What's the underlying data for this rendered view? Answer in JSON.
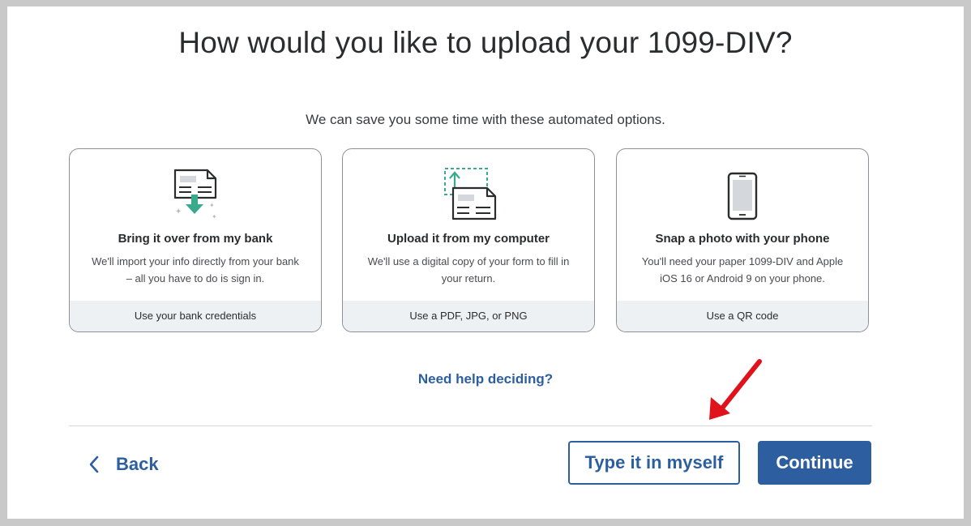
{
  "page": {
    "title": "How would you like to upload your 1099-DIV?",
    "subtitle": "We can save you some time with these automated options."
  },
  "options": [
    {
      "icon": "bank-import-icon",
      "heading": "Bring it over from my bank",
      "description": "We'll import your info directly from your bank – all you have to do is sign in.",
      "footer": "Use your bank credentials"
    },
    {
      "icon": "computer-upload-icon",
      "heading": "Upload it from my computer",
      "description": "We'll use a digital copy of your form to fill in your return.",
      "footer": "Use a PDF, JPG, or PNG"
    },
    {
      "icon": "phone-icon",
      "heading": "Snap a photo with your phone",
      "description": "You'll need your paper 1099-DIV and Apple iOS 16 or Android 9 on your phone.",
      "footer": "Use a QR code"
    }
  ],
  "help_link": "Need help deciding?",
  "nav": {
    "back_label": "Back",
    "type_label": "Type it in myself",
    "continue_label": "Continue"
  },
  "colors": {
    "brand_blue": "#2d5fa0",
    "accent_green": "#2ca01c",
    "annotation_red": "#e0121b",
    "footer_bg": "#eef1f4"
  }
}
